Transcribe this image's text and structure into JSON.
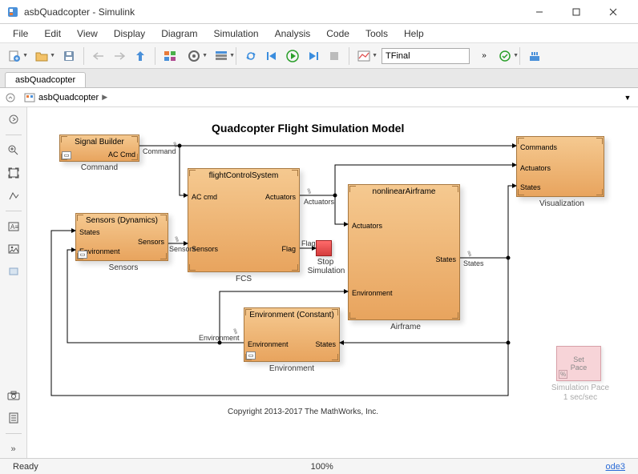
{
  "window": {
    "title": "asbQuadcopter - Simulink"
  },
  "menu": [
    "File",
    "Edit",
    "View",
    "Display",
    "Diagram",
    "Simulation",
    "Analysis",
    "Code",
    "Tools",
    "Help"
  ],
  "toolbar": {
    "stop_time_field": "TFinal"
  },
  "tabs": [
    "asbQuadcopter"
  ],
  "breadcrumb": {
    "model_icon": "model-icon",
    "model": "asbQuadcopter"
  },
  "canvas": {
    "title": "Quadcopter Flight Simulation Model",
    "copyright": "Copyright 2013-2017 The MathWorks, Inc.",
    "blocks": {
      "signal_builder": {
        "title": "Signal Builder",
        "out1": "AC Cmd",
        "label": "Command"
      },
      "sensors": {
        "title": "Sensors (Dynamics)",
        "in1": "States",
        "in2": "Environment",
        "out1": "Sensors",
        "label": "Sensors"
      },
      "fcs": {
        "title": "flightControlSystem",
        "in1": "AC cmd",
        "in2": "Sensors",
        "out1": "Actuators",
        "out2": "Flag",
        "label": "FCS"
      },
      "stop": {
        "in1": "Flag",
        "label_l1": "Stop",
        "label_l2": "Simulation"
      },
      "airframe": {
        "title": "nonlinearAirframe",
        "in1": "Actuators",
        "in2": "Environment",
        "out1": "States",
        "label": "Airframe"
      },
      "environment": {
        "title": "Environment (Constant)",
        "in1": "Environment",
        "out1": "States",
        "label": "Environment"
      },
      "visualization": {
        "in1": "Commands",
        "in2": "Actuators",
        "in3": "States",
        "label": "Visualization"
      },
      "pace": {
        "l1": "Set",
        "l2": "Pace",
        "label_l1": "Simulation Pace",
        "label_l2": "1 sec/sec"
      }
    },
    "signals": {
      "command": "Command",
      "sensors": "Sensors",
      "actuators": "Actuators",
      "flag": "Flag",
      "states": "States",
      "environment": "Environment"
    }
  },
  "status": {
    "ready": "Ready",
    "zoom": "100%",
    "solver": "ode3"
  },
  "colors": {
    "block_fill_top": "#f5c990",
    "block_fill_bot": "#e8a45e",
    "block_border": "#a87840"
  },
  "chart_data": {
    "type": "diagram",
    "title": "Quadcopter Flight Simulation Model",
    "nodes": [
      {
        "id": "Command",
        "block_title": "Signal Builder",
        "inputs": [],
        "outputs": [
          "AC Cmd"
        ]
      },
      {
        "id": "Sensors",
        "block_title": "Sensors (Dynamics)",
        "inputs": [
          "States",
          "Environment"
        ],
        "outputs": [
          "Sensors"
        ]
      },
      {
        "id": "FCS",
        "block_title": "flightControlSystem",
        "inputs": [
          "AC cmd",
          "Sensors"
        ],
        "outputs": [
          "Actuators",
          "Flag"
        ]
      },
      {
        "id": "Stop Simulation",
        "block_title": "Stop Simulation",
        "inputs": [
          "Flag"
        ],
        "outputs": []
      },
      {
        "id": "Airframe",
        "block_title": "nonlinearAirframe",
        "inputs": [
          "Actuators",
          "Environment"
        ],
        "outputs": [
          "States"
        ]
      },
      {
        "id": "Environment",
        "block_title": "Environment (Constant)",
        "inputs": [
          "Environment"
        ],
        "outputs": [
          "States"
        ]
      },
      {
        "id": "Visualization",
        "block_title": "Visualization",
        "inputs": [
          "Commands",
          "Actuators",
          "States"
        ],
        "outputs": []
      },
      {
        "id": "Simulation Pace",
        "block_title": "Set Pace",
        "inputs": [],
        "outputs": []
      }
    ],
    "edges": [
      {
        "from": "Command.AC Cmd",
        "to": "FCS.AC cmd",
        "signal": "Command"
      },
      {
        "from": "Command.AC Cmd",
        "to": "Visualization.Commands",
        "signal": "Command"
      },
      {
        "from": "Sensors.Sensors",
        "to": "FCS.Sensors",
        "signal": "Sensors"
      },
      {
        "from": "FCS.Actuators",
        "to": "Airframe.Actuators",
        "signal": "Actuators"
      },
      {
        "from": "FCS.Actuators",
        "to": "Visualization.Actuators",
        "signal": "Actuators"
      },
      {
        "from": "FCS.Flag",
        "to": "Stop Simulation.Flag",
        "signal": "Flag"
      },
      {
        "from": "Airframe.States",
        "to": "Visualization.States",
        "signal": "States"
      },
      {
        "from": "Airframe.States",
        "to": "Sensors.States",
        "signal": "States"
      },
      {
        "from": "Airframe.States",
        "to": "Environment.Environment",
        "signal": "States"
      },
      {
        "from": "Environment.States",
        "to": "Airframe.Environment",
        "signal": "Environment"
      },
      {
        "from": "Environment.States",
        "to": "Sensors.Environment",
        "signal": "Environment"
      }
    ]
  }
}
